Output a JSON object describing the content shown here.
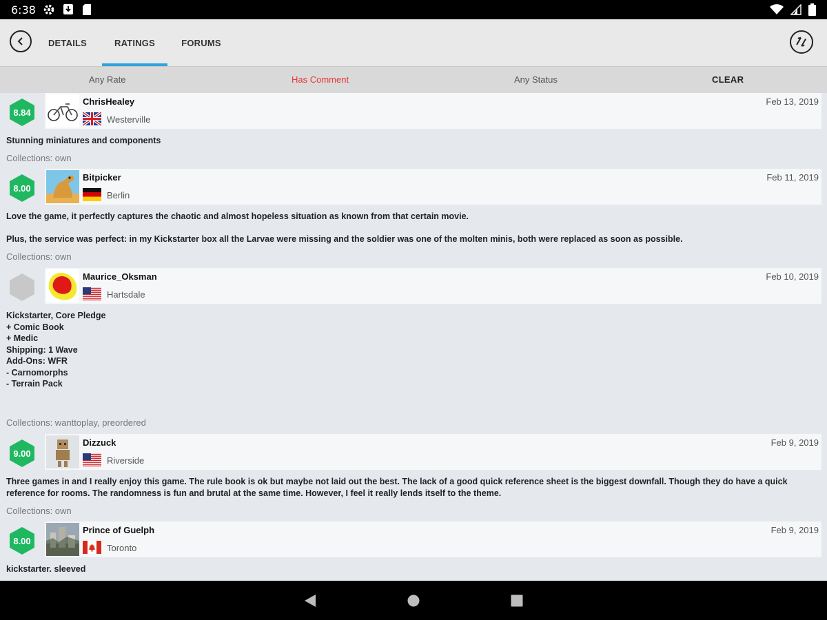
{
  "status_bar": {
    "time": "6:38"
  },
  "tabs": [
    {
      "label": "DETAILS"
    },
    {
      "label": "RATINGS",
      "active": true
    },
    {
      "label": "FORUMS"
    }
  ],
  "filters": {
    "rate": "Any Rate",
    "comment": "Has Comment",
    "status": "Any Status",
    "clear": "CLEAR"
  },
  "colors": {
    "accent": "#2fa4dc",
    "filter_active": "#e53935",
    "rating_green": "#1fb860",
    "rating_none": "#c8c8c8"
  },
  "ratings": [
    {
      "score": "8.84",
      "username": "ChrisHealey",
      "location": "Westerville",
      "flag": "uk-flag",
      "avatar": "bicycle-avatar",
      "date": "Feb 13, 2019",
      "comment": "Stunning miniatures and components",
      "collections": "Collections:  own"
    },
    {
      "score": "8.00",
      "username": "Bitpicker",
      "location": "Berlin",
      "flag": "germany-flag",
      "avatar": "camel-avatar",
      "date": "Feb 11, 2019",
      "comment": "Love the game, it perfectly captures the chaotic and almost hopeless situation as known from that certain movie.\n\nPlus, the service was perfect: in my Kickstarter box all the Larvae were missing and the soldier was one of the molten minis, both were replaced as soon as possible.",
      "collections": "Collections:  own"
    },
    {
      "score": "",
      "username": "Maurice_Oksman",
      "location": "Hartsdale",
      "flag": "usa-flag",
      "avatar": "red-blob-avatar",
      "date": "Feb 10, 2019",
      "comment": "Kickstarter, Core Pledge\n+ Comic Book\n+ Medic\nShipping: 1 Wave\nAdd-Ons: WFR\n- Carnomorphs\n- Terrain Pack",
      "collections": "Collections:  wanttoplay, preordered"
    },
    {
      "score": "9.00",
      "username": "Dizzuck",
      "location": "Riverside",
      "flag": "usa-flag",
      "avatar": "cardboard-robot-avatar",
      "date": "Feb 9, 2019",
      "comment": "Three games in and I really enjoy this game. The rule book is ok but maybe not laid out the best. The lack of a good quick reference sheet is the biggest downfall. Though they do have a quick reference for rooms. The randomness is fun and brutal at the same time. However, I feel it really lends itself to the theme.",
      "collections": "Collections:  own"
    },
    {
      "score": "8.00",
      "username": "Prince of Guelph",
      "location": "Toronto",
      "flag": "canada-flag",
      "avatar": "city-photo-avatar",
      "date": "Feb 9, 2019",
      "comment": "kickstarter. sleeved",
      "collections": ""
    }
  ]
}
